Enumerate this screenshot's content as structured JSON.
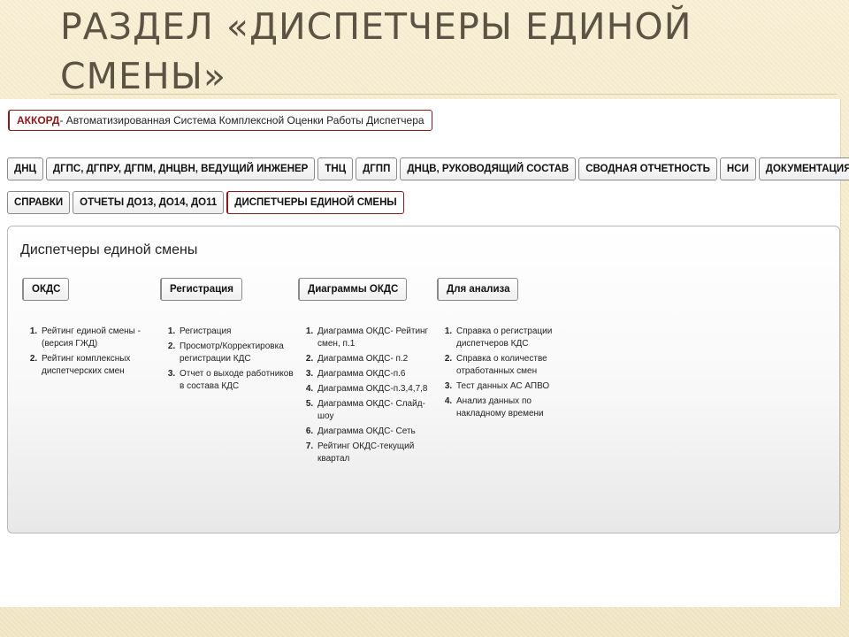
{
  "slide": {
    "title": "РАЗДЕЛ «ДИСПЕТЧЕРЫ ЕДИНОЙ СМЕНЫ»"
  },
  "app": {
    "brand": "АККОРД",
    "subtitle": " - Автоматизированная Система Комплексной Оценки Работы Диспетчера"
  },
  "tabs_row1": [
    {
      "label": "ДНЦ"
    },
    {
      "label": "ДГПС, ДГПРУ, ДГПМ, ДНЦВН, ВЕДУЩИЙ ИНЖЕНЕР"
    },
    {
      "label": "ТНЦ"
    },
    {
      "label": "ДГПП"
    },
    {
      "label": "ДНЦВ, РУКОВОДЯЩИЙ СОСТАВ"
    },
    {
      "label": "СВОДНАЯ ОТЧЕТНОСТЬ"
    },
    {
      "label": "НСИ"
    },
    {
      "label": "ДОКУМЕНТАЦИЯ"
    }
  ],
  "tabs_row2": [
    {
      "label": "СПРАВКИ"
    },
    {
      "label": "ОТЧЕТЫ ДО13, ДО14, ДО11"
    },
    {
      "label": "ДИСПЕТЧЕРЫ ЕДИНОЙ СМЕНЫ"
    }
  ],
  "panel": {
    "title": "Диспетчеры единой смены",
    "sections": [
      {
        "button": "ОКДС",
        "items": [
          "Рейтинг единой смены - (версия ГЖД)",
          "Рейтинг комплексных диспетчерских смен"
        ]
      },
      {
        "button": "Регистрация",
        "items": [
          "Регистрация",
          "Просмотр/Корректировка регистрации КДС",
          "Отчет о выходе работников в состава КДС"
        ]
      },
      {
        "button": "Диаграммы ОКДС",
        "items": [
          "Диаграмма ОКДС- Рейтинг смен, п.1",
          "Диаграмма ОКДС- п.2",
          "Диаграмма ОКДС-п.6",
          "Диаграмма ОКДС-п.3,4,7,8",
          "Диаграмма ОКДС- Слайд-шоу",
          "Диаграмма ОКДС- Сеть",
          "Рейтинг ОКДС-текущий квартал"
        ]
      },
      {
        "button": "Для анализа",
        "items": [
          "Справка о регистрации диспетчеров КДС",
          "Справка о количестве отработанных смен",
          "Тест данных АС АПВО",
          "Анализ данных по накладному времени"
        ]
      }
    ]
  }
}
